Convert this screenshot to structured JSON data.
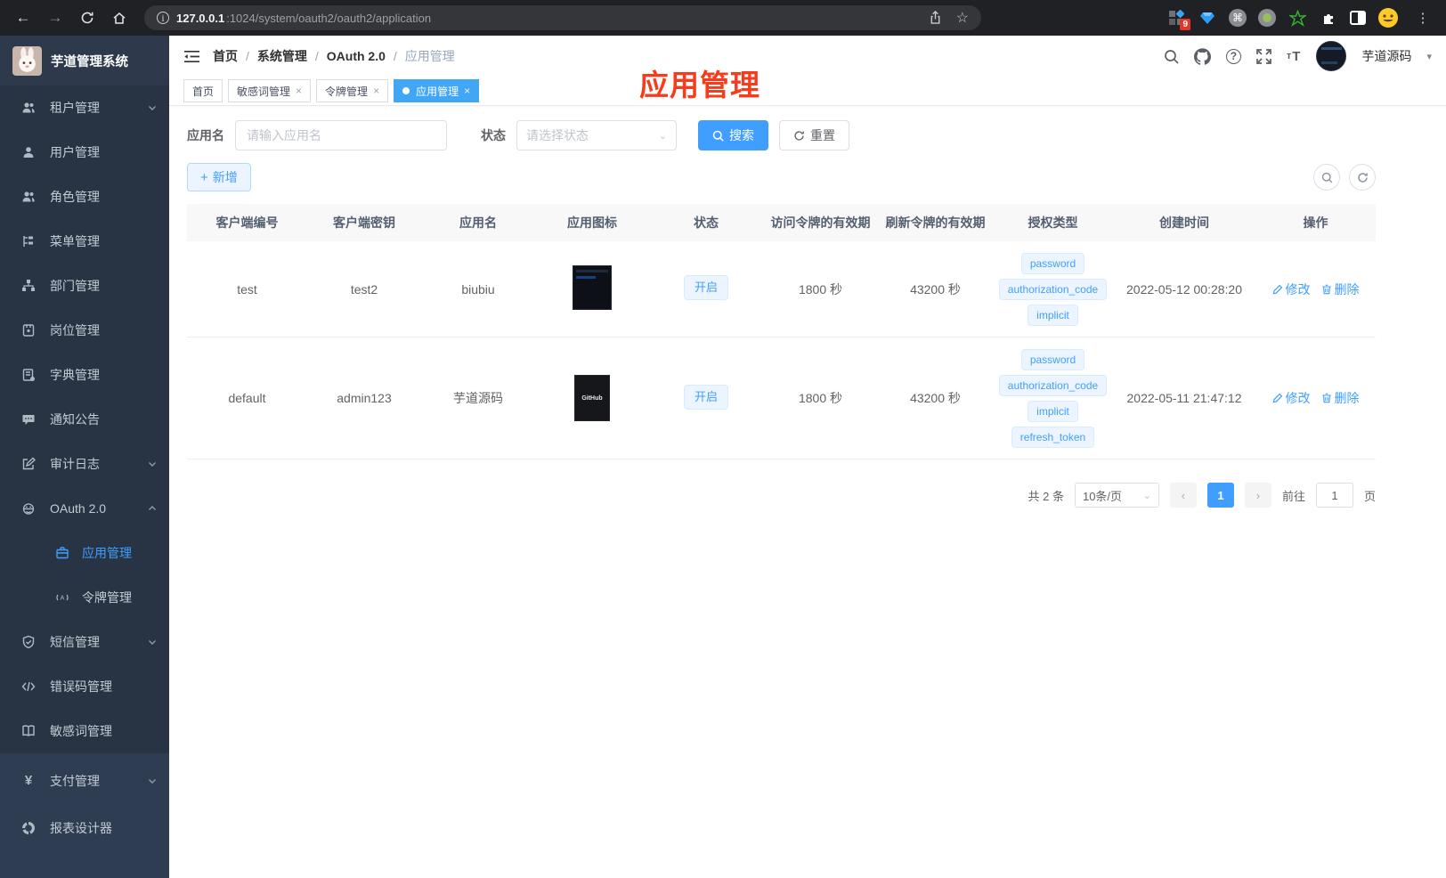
{
  "colors": {
    "accent": "#409eff",
    "annotation_red": "#f63c1d",
    "sidebar_bg": "#283443",
    "tab_active": "#41a7f5"
  },
  "browser": {
    "url_host": "127.0.0.1",
    "url_rest": ":1024/system/oauth2/oauth2/application",
    "extension_badge": "9"
  },
  "sidebar": {
    "logo_title": "芋道管理系统",
    "items": [
      {
        "label": "租户管理"
      },
      {
        "label": "用户管理"
      },
      {
        "label": "角色管理"
      },
      {
        "label": "菜单管理"
      },
      {
        "label": "部门管理"
      },
      {
        "label": "岗位管理"
      },
      {
        "label": "字典管理"
      },
      {
        "label": "通知公告"
      },
      {
        "label": "审计日志"
      },
      {
        "label": "OAuth 2.0"
      },
      {
        "label": "应用管理"
      },
      {
        "label": "令牌管理"
      },
      {
        "label": "短信管理"
      },
      {
        "label": "错误码管理"
      },
      {
        "label": "敏感词管理"
      },
      {
        "label": "支付管理"
      },
      {
        "label": "报表设计器"
      }
    ]
  },
  "header": {
    "breadcrumb": [
      "首页",
      "系统管理",
      "OAuth 2.0",
      "应用管理"
    ],
    "username": "芋道源码"
  },
  "tabs": [
    {
      "label": "首页"
    },
    {
      "label": "敏感词管理"
    },
    {
      "label": "令牌管理"
    },
    {
      "label": "应用管理"
    }
  ],
  "annotation": "应用管理",
  "filter": {
    "name_label": "应用名",
    "name_placeholder": "请输入应用名",
    "status_label": "状态",
    "status_placeholder": "请选择状态",
    "search_label": "搜索",
    "reset_label": "重置"
  },
  "toolbar": {
    "add_label": "新增"
  },
  "table": {
    "columns": [
      "客户端编号",
      "客户端密钥",
      "应用名",
      "应用图标",
      "状态",
      "访问令牌的有效期",
      "刷新令牌的有效期",
      "授权类型",
      "创建时间",
      "操作"
    ],
    "rows": [
      {
        "client_id": "test",
        "secret": "test2",
        "name": "biubiu",
        "status": "开启",
        "access_ttl": "1800 秒",
        "refresh_ttl": "43200 秒",
        "grants": [
          "password",
          "authorization_code",
          "implicit"
        ],
        "created": "2022-05-12 00:28:20",
        "edit": "修改",
        "delete": "删除"
      },
      {
        "client_id": "default",
        "secret": "admin123",
        "name": "芋道源码",
        "icon_text": "GitHub",
        "status": "开启",
        "access_ttl": "1800 秒",
        "refresh_ttl": "43200 秒",
        "grants": [
          "password",
          "authorization_code",
          "implicit",
          "refresh_token"
        ],
        "created": "2022-05-11 21:47:12",
        "edit": "修改",
        "delete": "删除"
      }
    ]
  },
  "pagination": {
    "total": "共 2 条",
    "page_size": "10条/页",
    "current": "1",
    "goto_label": "前往",
    "goto_value": "1",
    "page_suffix": "页"
  }
}
